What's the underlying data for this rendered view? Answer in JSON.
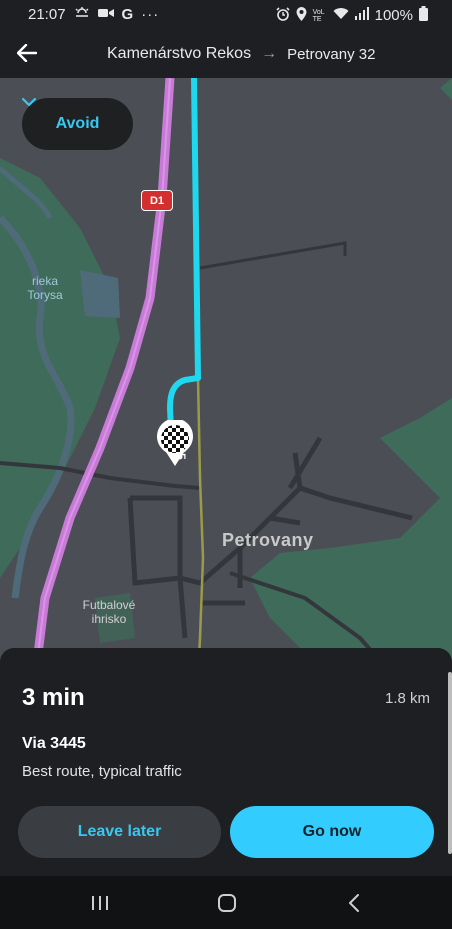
{
  "status_bar": {
    "time": "21:07",
    "battery": "100%",
    "left_icons": [
      "weather-icon",
      "video-icon",
      "google-icon",
      "more-dots-icon"
    ],
    "right_icons": [
      "alarm-icon",
      "location-icon",
      "volte-icon",
      "wifi-icon",
      "signal-icon",
      "battery-icon"
    ],
    "volte_text": "VoLTE"
  },
  "header": {
    "origin": "Kamenárstvo Rekos",
    "destination": "Petrovany 32"
  },
  "map": {
    "avoid_label": "Avoid",
    "road_sign": "D1",
    "road_number": "3445",
    "labels": {
      "river": "rieka\nTorysa",
      "football": "Futbalové\nihrisko",
      "town": "Petrovany"
    },
    "colors": {
      "route": "#1fd8f0",
      "highway": "#c97ad8",
      "forest": "#3f6b5a",
      "water": "#4f6b7a"
    }
  },
  "route": {
    "eta": "3 min",
    "distance": "1.8 km",
    "via": "Via 3445",
    "description": "Best route, typical traffic"
  },
  "actions": {
    "leave_later": "Leave later",
    "go_now": "Go now"
  }
}
